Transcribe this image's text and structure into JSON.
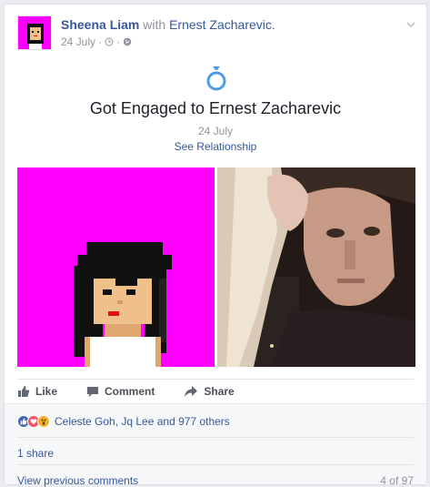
{
  "post": {
    "author": "Sheena Liam",
    "with_text": "with",
    "tagged": "Ernest Zacharevic.",
    "date": "24 July",
    "meta_dots": "·",
    "meta_dot2": "·"
  },
  "event": {
    "icon": "engagement-ring-icon",
    "title": "Got Engaged to Ernest Zacharevic",
    "date": "24 July",
    "link": "See Relationship"
  },
  "actions": {
    "like": "Like",
    "comment": "Comment",
    "share": "Share"
  },
  "footer": {
    "reactions_text": "Celeste Goh, Jq Lee and 977 others",
    "shares": "1 share",
    "prev_comments": "View previous comments",
    "comment_count": "4 of 97"
  },
  "colors": {
    "link": "#365899",
    "magenta": "#ff00ff",
    "like_blue": "#4267b2",
    "love_red": "#f25268",
    "wow_yellow": "#f7b125"
  }
}
